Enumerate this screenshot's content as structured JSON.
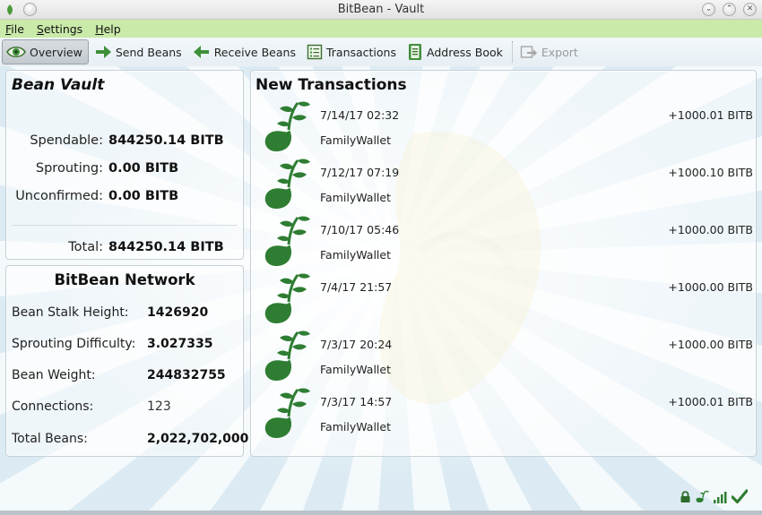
{
  "window": {
    "title": "BitBean - Vault"
  },
  "menu": {
    "file": "File",
    "settings": "Settings",
    "help": "Help"
  },
  "toolbar": {
    "overview": "Overview",
    "send": "Send Beans",
    "receive": "Receive Beans",
    "transactions": "Transactions",
    "address_book": "Address Book",
    "export": "Export"
  },
  "vault": {
    "title": "Bean Vault",
    "spendable_label": "Spendable:",
    "spendable_value": "844250.14 BITB",
    "sprouting_label": "Sprouting:",
    "sprouting_value": "0.00 BITB",
    "unconfirmed_label": "Unconfirmed:",
    "unconfirmed_value": "0.00 BITB",
    "total_label": "Total:",
    "total_value": "844250.14 BITB"
  },
  "network": {
    "title": "BitBean Network",
    "rows": [
      {
        "label": "Bean Stalk Height:",
        "value": "1426920"
      },
      {
        "label": "Sprouting Difficulty:",
        "value": "3.027335"
      },
      {
        "label": "Bean Weight:",
        "value": "244832755"
      },
      {
        "label": "Connections:",
        "value": "123"
      },
      {
        "label": "Total Beans:",
        "value": "2,022,702,000"
      }
    ]
  },
  "transactions": {
    "title": "New Transactions",
    "items": [
      {
        "date": "7/14/17 02:32",
        "amount": "+1000.01 BITB",
        "label": "FamilyWallet"
      },
      {
        "date": "7/12/17 07:19",
        "amount": "+1000.10 BITB",
        "label": "FamilyWallet"
      },
      {
        "date": "7/10/17 05:46",
        "amount": "+1000.00 BITB",
        "label": "FamilyWallet"
      },
      {
        "date": "7/4/17 21:57",
        "amount": "+1000.00 BITB",
        "label": ""
      },
      {
        "date": "7/3/17 20:24",
        "amount": "+1000.00 BITB",
        "label": "FamilyWallet"
      },
      {
        "date": "7/3/17 14:57",
        "amount": "+1000.01 BITB",
        "label": "FamilyWallet"
      }
    ]
  },
  "colors": {
    "menubar": "#c9eaa9",
    "sprout": "#2e7d32",
    "accent_green": "#3f8f3a"
  },
  "icons": {
    "overview": "eye-icon",
    "send": "arrow-right-icon",
    "receive": "arrow-left-icon",
    "transactions": "list-icon",
    "address_book": "book-icon",
    "export": "export-icon",
    "status": [
      "lock-icon",
      "sprout-status-icon",
      "signal-bars-icon",
      "checkmark-icon"
    ]
  }
}
